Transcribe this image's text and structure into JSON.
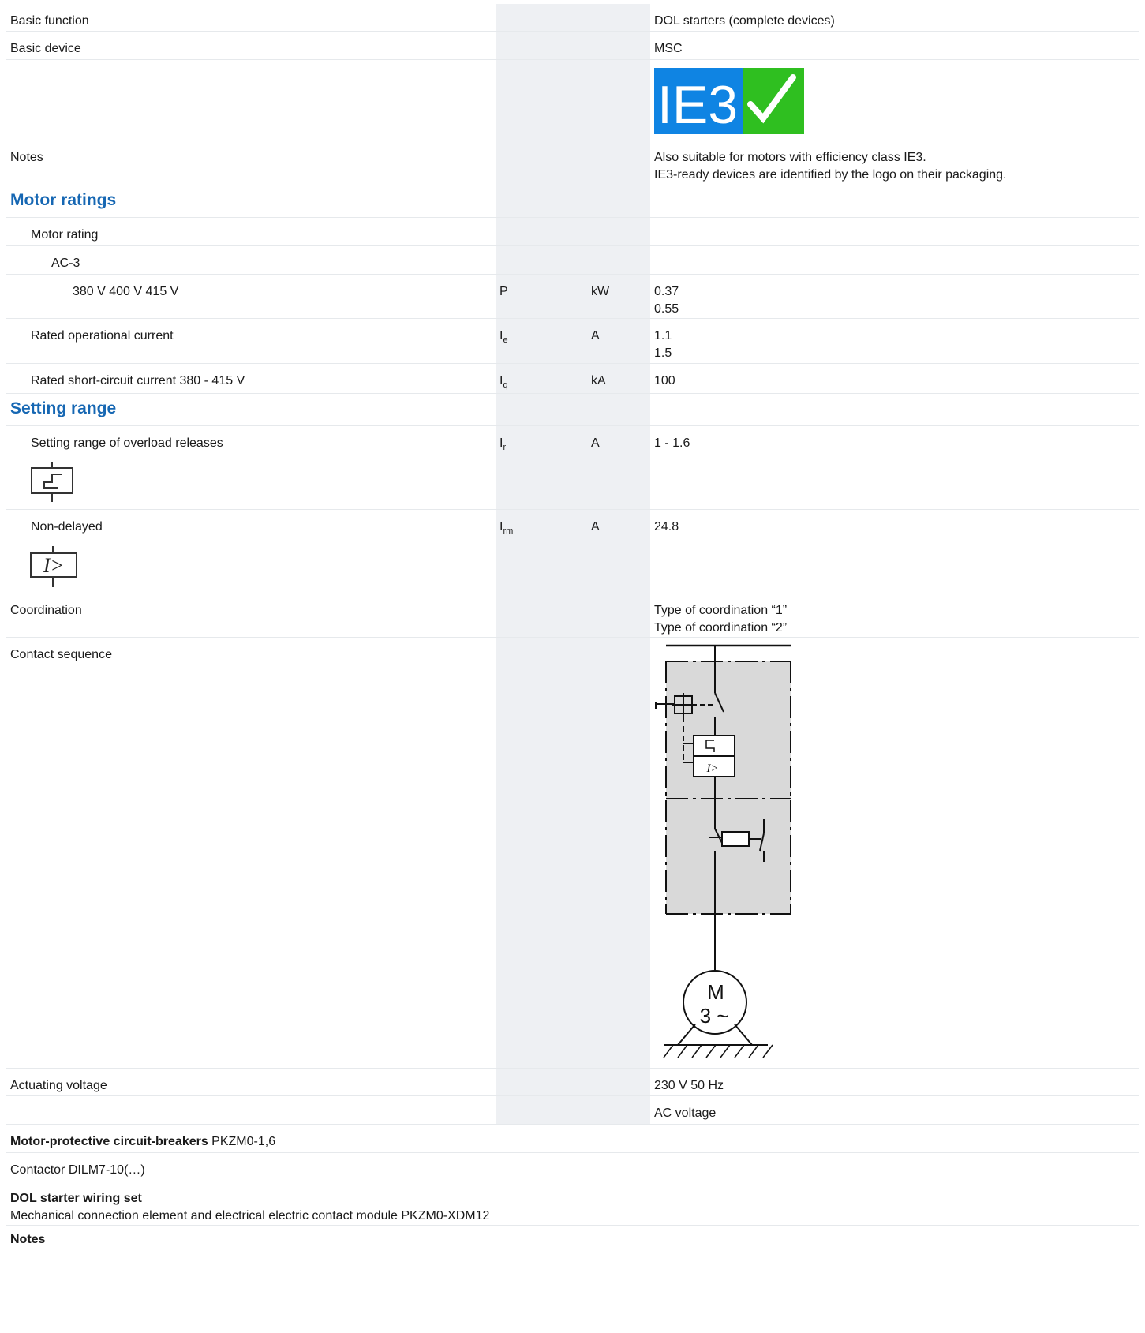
{
  "rows": {
    "basic_function": {
      "label": "Basic function",
      "value": "DOL starters (complete devices)"
    },
    "basic_device": {
      "label": "Basic device",
      "value": "MSC"
    },
    "ie3_logo": {
      "text": "IE3",
      "check": "✓",
      "left_color": "#0f84e3",
      "right_color": "#2fbf20"
    },
    "notes": {
      "label": "Notes",
      "value_line1": "Also suitable for motors with efficiency class IE3.",
      "value_line2": "IE3-ready devices are identified by the logo on their packaging."
    },
    "motor_ratings_heading": "Motor ratings",
    "motor_rating": "Motor rating",
    "ac3": "AC-3",
    "voltage_row": {
      "label": "380 V 400 V 415 V",
      "symbol": "P",
      "unit": "kW",
      "value_line1": "0.37",
      "value_line2": "0.55"
    },
    "rated_current": {
      "label": "Rated operational current",
      "symbol": "I",
      "symbol_sub": "e",
      "unit": "A",
      "value_line1": "1.1",
      "value_line2": "1.5"
    },
    "short_circuit": {
      "label": "Rated short-circuit current 380 - 415 V",
      "symbol": "I",
      "symbol_sub": "q",
      "unit": "kA",
      "value": "100"
    },
    "setting_range_heading": "Setting range",
    "overload": {
      "label": "Setting range of overload releases",
      "symbol": "I",
      "symbol_sub": "r",
      "unit": "A",
      "value": "1 - 1.6",
      "icon": "thermal-overload-icon"
    },
    "non_delayed": {
      "label": "Non-delayed",
      "symbol": "I",
      "symbol_sub": "rm",
      "unit": "A",
      "value": "24.8",
      "icon": "magnetic-release-icon",
      "icon_text": "I>"
    },
    "coordination": {
      "label": "Coordination",
      "value_line1": "Type of coordination “1”",
      "value_line2": "Type of coordination “2”"
    },
    "contact_sequence": {
      "label": "Contact sequence",
      "diagram_text_i": "I>",
      "motor_m": "M",
      "motor_phase": "3 ~"
    },
    "actuating_voltage": {
      "label": "Actuating voltage",
      "value": "230 V 50 Hz"
    },
    "ac_voltage": {
      "value": "AC voltage"
    }
  },
  "footer": {
    "mpcb_bold": "Motor-protective circuit-breakers",
    "mpcb_rest": " PKZM0-1,6",
    "contactor": "Contactor DILM7-10(…)",
    "wiring_bold": "DOL starter wiring set",
    "wiring_rest": "Mechanical connection element and electrical electric contact module PKZM0-XDM12",
    "notes_bold": "Notes"
  },
  "colors": {
    "heading_blue": "#1667b3",
    "shaded_column": "#eef0f3",
    "diagram_fill": "#d9d9d9"
  }
}
